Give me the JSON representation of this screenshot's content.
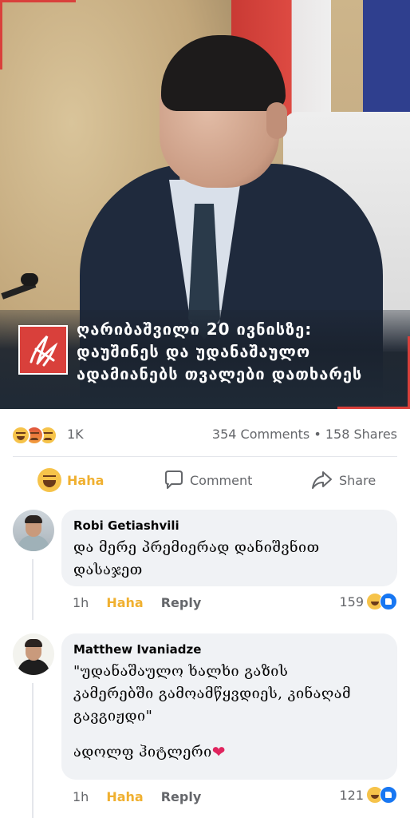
{
  "post": {
    "headline_lines": [
      "ღარიბაშვილი 20 ივნისზე:",
      "დაუშინეს და უდანაშაულო",
      "ადამიანებს თვალები დათხარეს"
    ],
    "reactions_count": "1K",
    "comments_shares": "354 Comments • 158 Shares",
    "actions": {
      "haha": "Haha",
      "comment": "Comment",
      "share": "Share"
    }
  },
  "comments": [
    {
      "author": "Robi Getiashvili",
      "text_lines": [
        "და მერე პრემიერად დანიშვნით",
        "დასაჯეთ"
      ],
      "time": "1h",
      "reaction_label": "Haha",
      "reply_label": "Reply",
      "reaction_count": "159"
    },
    {
      "author": "Matthew Ivaniadze",
      "text_lines": [
        "\"უდანაშაულო ხალხი გაზის",
        "კამერებში გამოამწყვდიეს, კინაღამ",
        "გავგიჟდი\""
      ],
      "signature": "ადოლფ ჰიტლერი",
      "heart": "❤",
      "time": "1h",
      "reaction_label": "Haha",
      "reply_label": "Reply",
      "reaction_count": "121"
    }
  ],
  "colors": {
    "accent_red": "#d9403b",
    "haha_yellow": "#f0b030",
    "like_blue": "#1877f2",
    "muted_text": "#65676b",
    "bubble_bg": "#f0f2f5"
  },
  "icons": [
    "haha-emoji-icon",
    "angry-emoji-icon",
    "sad-emoji-icon",
    "comment-icon",
    "share-icon",
    "like-icon",
    "heart-icon"
  ]
}
